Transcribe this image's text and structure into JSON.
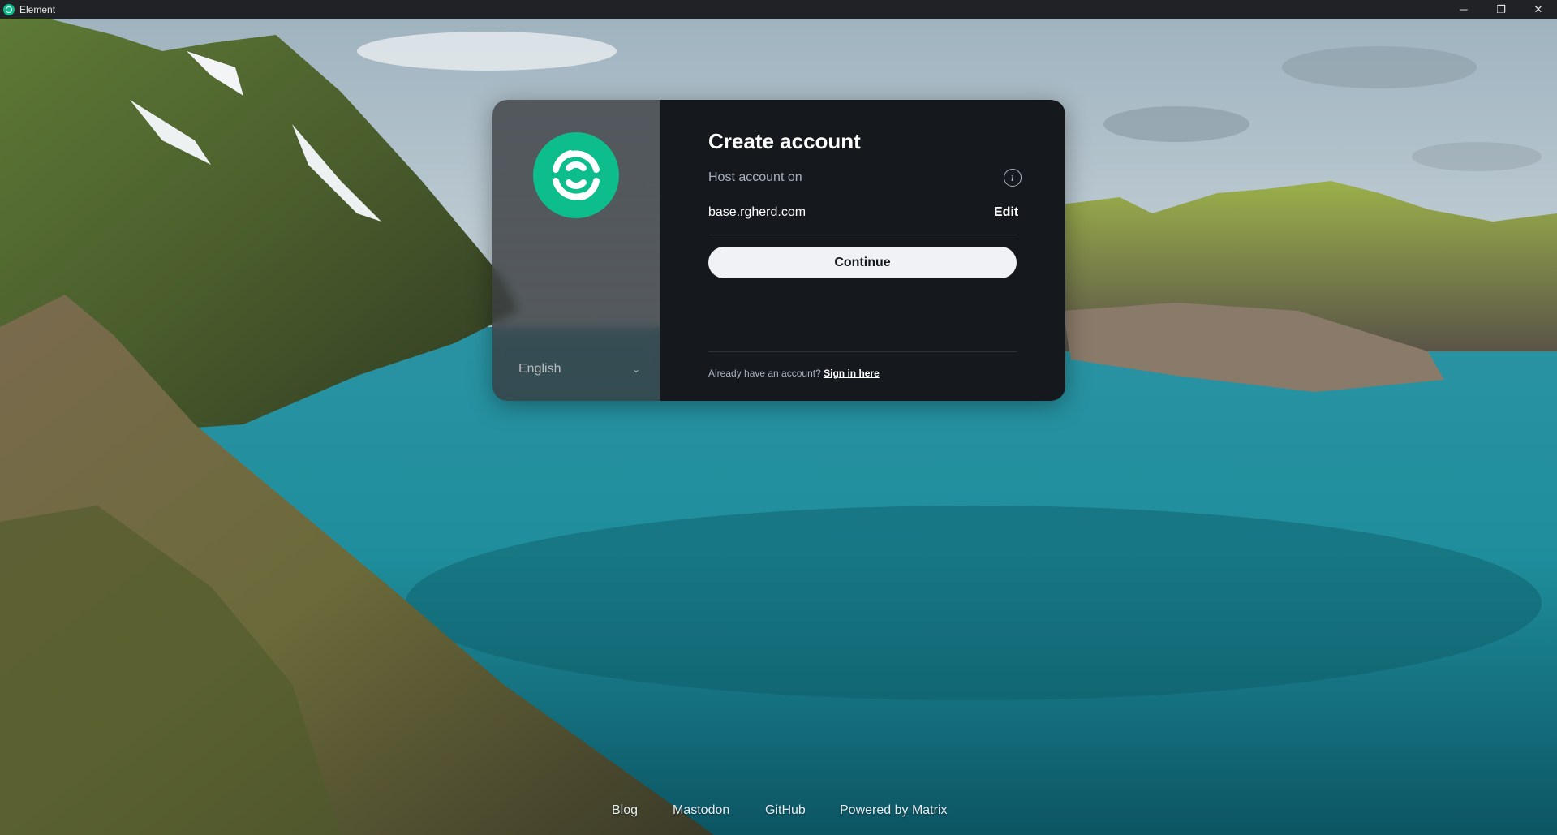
{
  "window": {
    "title": "Element",
    "minimize_glyph": "─",
    "restore_glyph": "❐",
    "close_glyph": "✕"
  },
  "modal": {
    "heading": "Create account",
    "host_label": "Host account on",
    "server_name": "base.rgherd.com",
    "edit_label": "Edit",
    "continue_label": "Continue",
    "already_text": "Already have an account?",
    "signin_label": "Sign in here",
    "language": "English",
    "info_glyph": "i",
    "chevron_glyph": "⌄"
  },
  "footer": {
    "links": [
      "Blog",
      "Mastodon",
      "GitHub",
      "Powered by Matrix"
    ]
  },
  "colors": {
    "brand": "#0dbd8b",
    "modal_bg": "#15191e",
    "button_bg": "#f0f2f5"
  },
  "icons": {
    "app": "element-logo-icon",
    "info": "info-icon",
    "chevron": "chevron-down-icon"
  }
}
